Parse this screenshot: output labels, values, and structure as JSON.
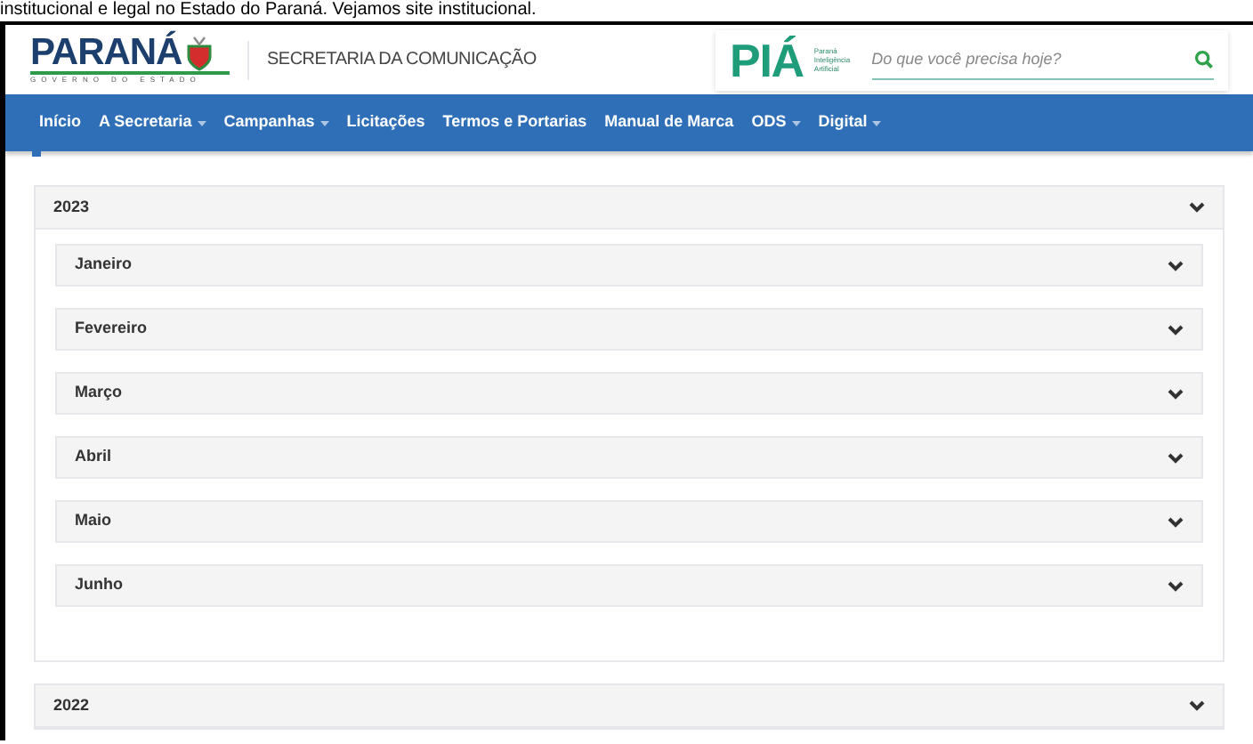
{
  "caption": "institucional e legal no Estado do Paraná. Vejamos site institucional.",
  "header": {
    "logo": "PARANÁ",
    "logo_subtitle": "GOVERNO DO ESTADO",
    "department": "SECRETARIA DA COMUNICAÇÃO",
    "pia_logo": "PIÁ",
    "pia_tagline": [
      "Paraná",
      "Inteligência",
      "Artificial"
    ],
    "search": {
      "placeholder": "Do que você precisa hoje?"
    }
  },
  "nav": [
    {
      "label": "Início",
      "dropdown": false
    },
    {
      "label": "A Secretaria",
      "dropdown": true
    },
    {
      "label": "Campanhas",
      "dropdown": true
    },
    {
      "label": "Licitações",
      "dropdown": false
    },
    {
      "label": "Termos e Portarias",
      "dropdown": false
    },
    {
      "label": "Manual de Marca",
      "dropdown": false
    },
    {
      "label": "ODS",
      "dropdown": true
    },
    {
      "label": "Digital",
      "dropdown": true
    }
  ],
  "years": [
    {
      "label": "2023",
      "expanded": true,
      "months": [
        "Janeiro",
        "Fevereiro",
        "Março",
        "Abril",
        "Maio",
        "Junho"
      ]
    },
    {
      "label": "2022",
      "expanded": false
    }
  ]
}
